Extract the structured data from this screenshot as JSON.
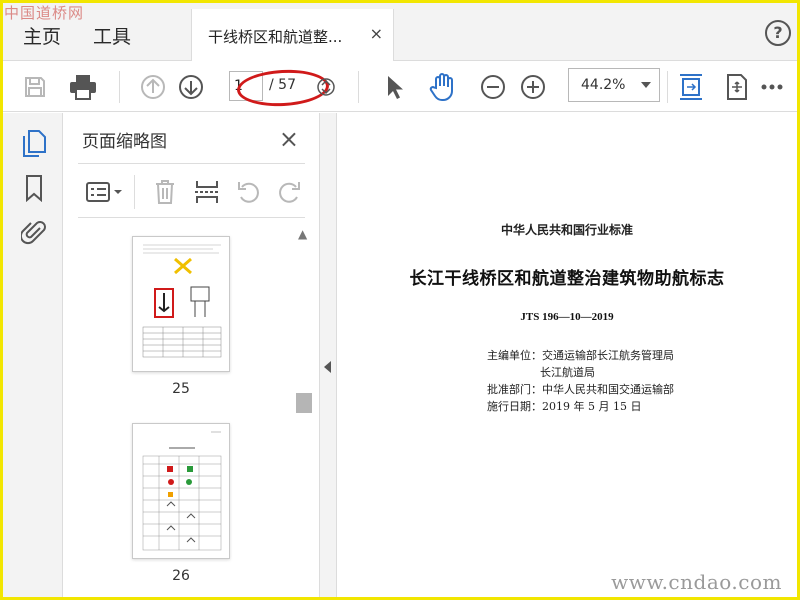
{
  "watermark_top": "中国道桥网",
  "watermark_bottom": "www.cndao.com",
  "menu": {
    "home": "主页",
    "tools": "工具"
  },
  "tab": {
    "title": "干线桥区和航道整...",
    "close": "×"
  },
  "help": "?",
  "toolbar": {
    "current_page": "1",
    "total_pages": "/ 57",
    "zoom": "44.2%"
  },
  "panel": {
    "title": "页面缩略图",
    "close": "×",
    "thumbnails": [
      {
        "label": "25"
      },
      {
        "label": "26"
      }
    ]
  },
  "document": {
    "header": "中华人民共和国行业标准",
    "title": "长江干线桥区和航道整治建筑物助航标志",
    "code": "JTS 196—10—2019",
    "meta": [
      "主编单位：交通运输部长江航务管理局",
      "长江航道局",
      "批准部门：中华人民共和国交通运输部",
      "施行日期：2019 年 5 月 15 日"
    ]
  },
  "colors": {
    "accent": "#2e72c8",
    "annotation": "#d01a1a",
    "frame": "#f2e600"
  }
}
